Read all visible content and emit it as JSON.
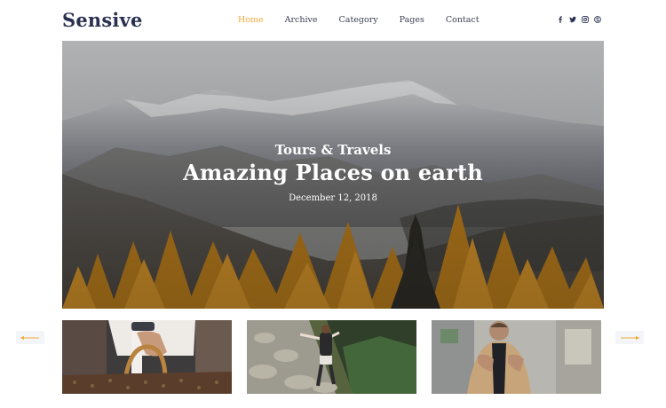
{
  "brand": {
    "name": "Sensive"
  },
  "nav": [
    {
      "label": "Home",
      "active": true
    },
    {
      "label": "Archive",
      "active": false
    },
    {
      "label": "Category",
      "active": false
    },
    {
      "label": "Pages",
      "active": false
    },
    {
      "label": "Contact",
      "active": false
    }
  ],
  "social": [
    "facebook-icon",
    "twitter-icon",
    "instagram-icon",
    "skype-icon"
  ],
  "hero": {
    "category": "Tours & Travels",
    "title": "Amazing Places on earth",
    "date": "December 12, 2018"
  },
  "thumbnails": [
    {
      "image": "handbag-photo"
    },
    {
      "image": "hiker-photo"
    },
    {
      "image": "man-in-coat-photo"
    }
  ],
  "carousel": {
    "prev_icon": "arrow-left-icon",
    "next_icon": "arrow-right-icon"
  },
  "colors": {
    "accent": "#f0ab3a",
    "brand": "#2a3150",
    "nav_text": "#3a3f52"
  }
}
